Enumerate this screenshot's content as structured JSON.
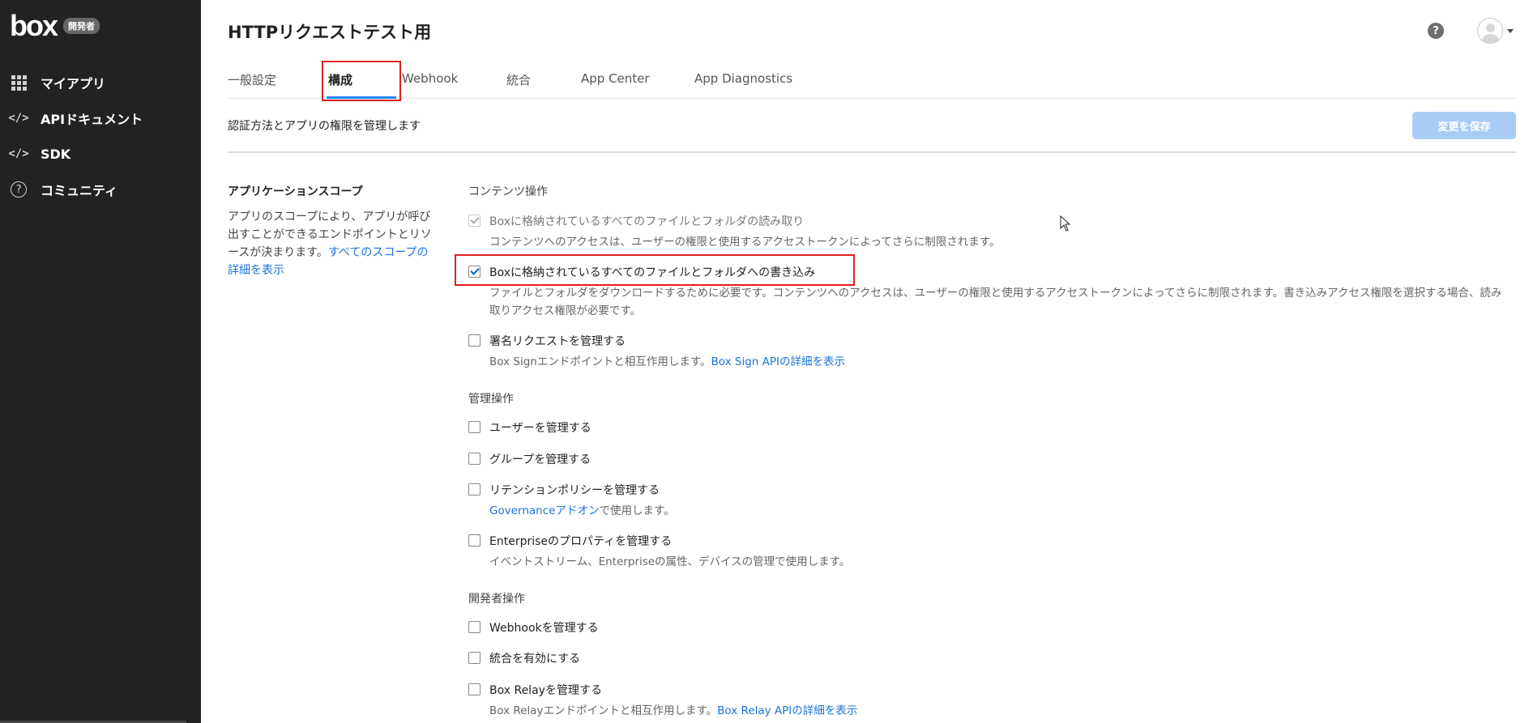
{
  "sidebar": {
    "brand": "box",
    "badge": "開発者",
    "items": [
      {
        "label": "マイアプリ"
      },
      {
        "label": "APIドキュメント"
      },
      {
        "label": "SDK"
      },
      {
        "label": "コミュニティ"
      }
    ]
  },
  "header": {
    "title": "HTTPリクエストテスト用",
    "help_glyph": "?"
  },
  "tabs": [
    {
      "label": "一般設定",
      "active": false
    },
    {
      "label": "構成",
      "active": true
    },
    {
      "label": "Webhook",
      "active": false
    },
    {
      "label": "統合",
      "active": false
    },
    {
      "label": "App Center",
      "active": false
    },
    {
      "label": "App Diagnostics",
      "active": false
    }
  ],
  "subheader": {
    "text": "認証方法とアプリの権限を管理します",
    "save_label": "変更を保存"
  },
  "scope": {
    "title": "アプリケーションスコープ",
    "desc": "アプリのスコープにより、アプリが呼び出すことができるエンドポイントとリソースが決まります。",
    "link": "すべてのスコープの詳細を表示"
  },
  "content_ops": {
    "title": "コンテンツ操作",
    "read": {
      "label": "Boxに格納されているすべてのファイルとフォルダの読み取り",
      "desc": "コンテンツへのアクセスは、ユーザーの権限と使用するアクセストークンによってさらに制限されます。",
      "checked": true,
      "disabled": true
    },
    "write": {
      "label": "Boxに格納されているすべてのファイルとフォルダへの書き込み",
      "desc": "ファイルとフォルダをダウンロードするために必要です。コンテンツへのアクセスは、ユーザーの権限と使用するアクセストークンによってさらに制限されます。書き込みアクセス権限を選択する場合、読み取りアクセス権限が必要です。",
      "checked": true
    },
    "sign": {
      "label": "署名リクエストを管理する",
      "desc": "Box Signエンドポイントと相互作用します。",
      "link": "Box Sign APIの詳細を表示",
      "checked": false
    }
  },
  "admin_ops": {
    "title": "管理操作",
    "users": {
      "label": "ユーザーを管理する",
      "checked": false
    },
    "groups": {
      "label": "グループを管理する",
      "checked": false
    },
    "retention": {
      "label": "リテンションポリシーを管理する",
      "desc_link": "Governanceアドオン",
      "desc": "で使用します。",
      "checked": false
    },
    "enterprise": {
      "label": "Enterpriseのプロパティを管理する",
      "desc": "イベントストリーム、Enterpriseの属性、デバイスの管理で使用します。",
      "checked": false
    }
  },
  "dev_ops": {
    "title": "開発者操作",
    "webhook": {
      "label": "Webhookを管理する",
      "checked": false
    },
    "integrations": {
      "label": "統合を有効にする",
      "checked": false
    },
    "relay": {
      "label": "Box Relayを管理する",
      "desc": "Box Relayエンドポイントと相互作用します。",
      "link": "Box Relay APIの詳細を表示",
      "checked": false
    }
  },
  "colors": {
    "sidebar_bg": "#222222",
    "accent": "#2486fc",
    "link": "#1a73d8",
    "highlight": "#e02020",
    "save_disabled": "#a8ccf4"
  }
}
